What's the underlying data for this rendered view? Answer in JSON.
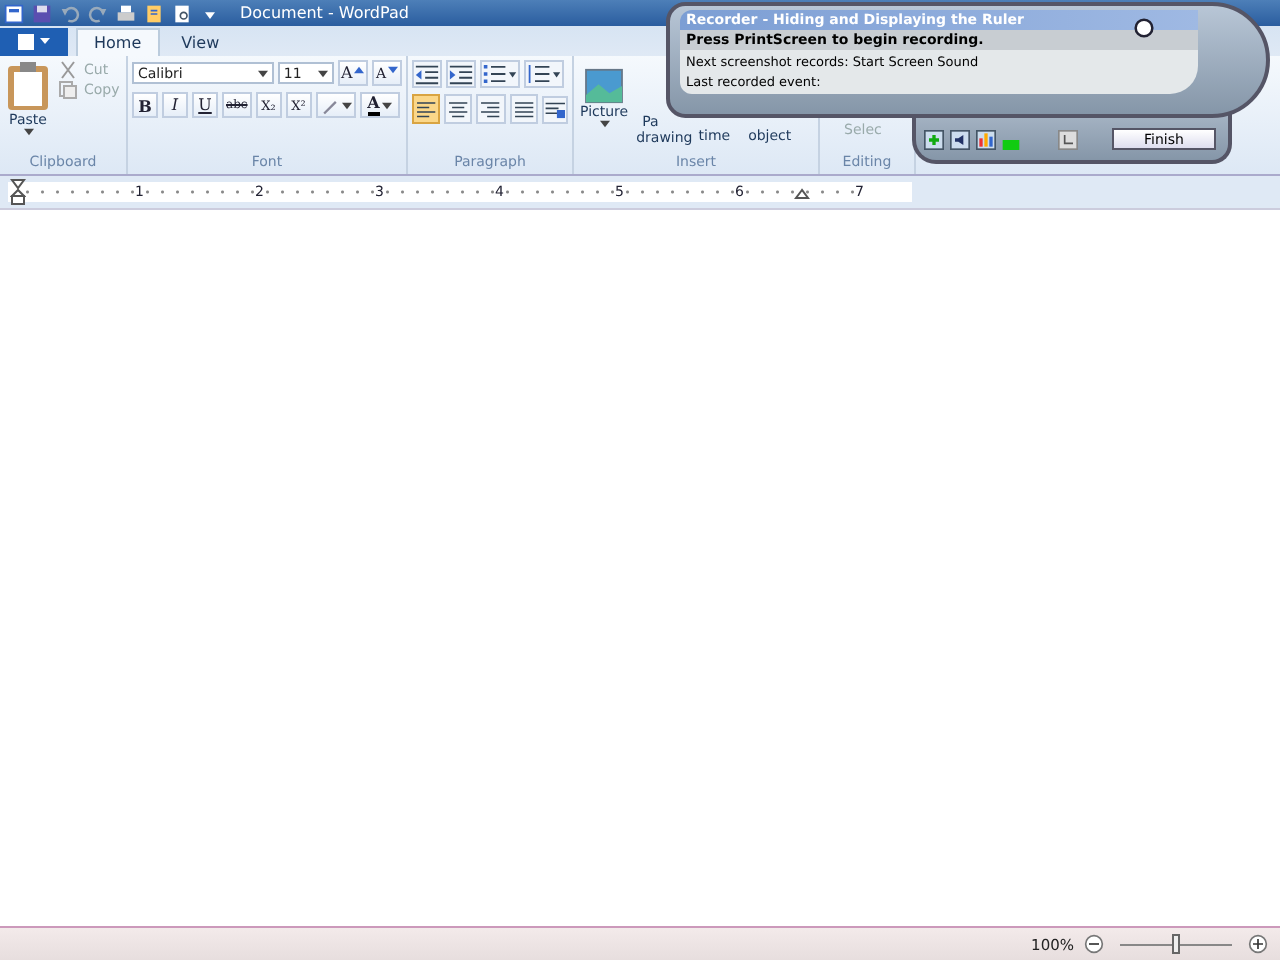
{
  "window": {
    "title": "Document - WordPad"
  },
  "tabs": [
    {
      "label": "Home",
      "selected": true
    },
    {
      "label": "View",
      "selected": false
    }
  ],
  "clipboard": {
    "paste": "Paste",
    "cut": "Cut",
    "copy": "Copy",
    "label": "Clipboard"
  },
  "font": {
    "family": "Calibri",
    "size": "11",
    "grow": "A",
    "shrink": "A",
    "styles": [
      "B",
      "I",
      "U",
      "abc",
      "X₂",
      "X²"
    ],
    "color_letter": "A",
    "label": "Font"
  },
  "paragraph": {
    "alignments": [
      {
        "selected": true
      },
      {
        "selected": false
      },
      {
        "selected": false
      },
      {
        "selected": false
      }
    ],
    "label": "Paragraph"
  },
  "insert": {
    "picture": "Picture",
    "paint_top": "Pa",
    "paint_bottom": "drawing",
    "time": "time",
    "object": "object",
    "label": "Insert"
  },
  "editing": {
    "select": "Selec",
    "label": "Editing"
  },
  "ruler": {
    "numbers": [
      "1",
      "2",
      "3",
      "4",
      "5",
      "6",
      "7"
    ]
  },
  "recorder": {
    "title": "Recorder - Hiding and Displaying the Ruler",
    "prompt": "Press PrintScreen to begin recording.",
    "next": "Next screenshot records: Start Screen Sound",
    "last": "Last recorded event:",
    "finish": "Finish"
  },
  "status_bar": {
    "zoom": "100%",
    "zoom_slider": {
      "level": 0.5
    }
  }
}
